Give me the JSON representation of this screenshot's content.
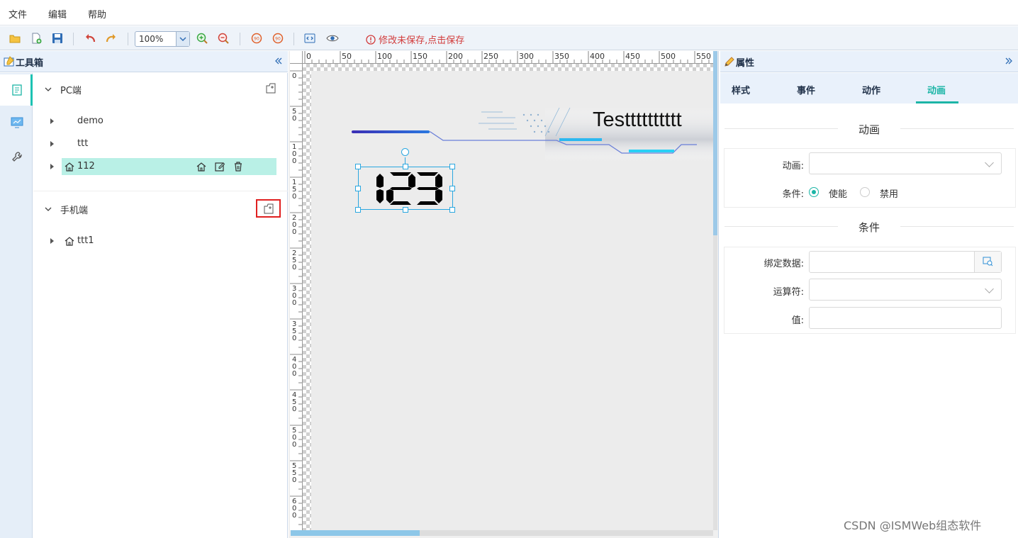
{
  "menu": {
    "items": [
      "文件",
      "编辑",
      "帮助"
    ]
  },
  "toolbar": {
    "zoom_value": "100%",
    "save_warning": "修改未保存,点击保存"
  },
  "left_panel": {
    "title": "工具箱",
    "groups": [
      {
        "label": "PC端",
        "items": [
          "demo",
          "ttt",
          "112"
        ]
      },
      {
        "label": "手机端",
        "items": [
          "ttt1"
        ]
      }
    ]
  },
  "ruler": {
    "top_ticks": [
      "0",
      "50",
      "100",
      "150",
      "200",
      "250",
      "300",
      "350",
      "400",
      "450",
      "500",
      "550"
    ],
    "left_ticks": [
      "0",
      "50",
      "100",
      "150",
      "200",
      "250",
      "300",
      "350",
      "400",
      "450",
      "500",
      "550",
      "600",
      "6"
    ]
  },
  "canvas": {
    "banner_title": "Testttttttttt",
    "digit_display": "123"
  },
  "right_panel": {
    "title": "属性",
    "tabs": [
      "样式",
      "事件",
      "动作",
      "动画"
    ],
    "active_tab": "动画",
    "animation_section": {
      "title": "动画",
      "animation_label": "动画:",
      "animation_value": "",
      "condition_label": "条件:",
      "radio_enable": "使能",
      "radio_disable": "禁用"
    },
    "condition_section": {
      "title": "条件",
      "bind_label": "绑定数据:",
      "operator_label": "运算符:",
      "value_label": "值:"
    }
  },
  "watermark": "CSDN @ISMWeb组态软件",
  "colors": {
    "accent": "#1cb5a6",
    "warning": "#d23c3c",
    "selection": "#2aa7e0",
    "selected_row": "#b9f0e6"
  }
}
